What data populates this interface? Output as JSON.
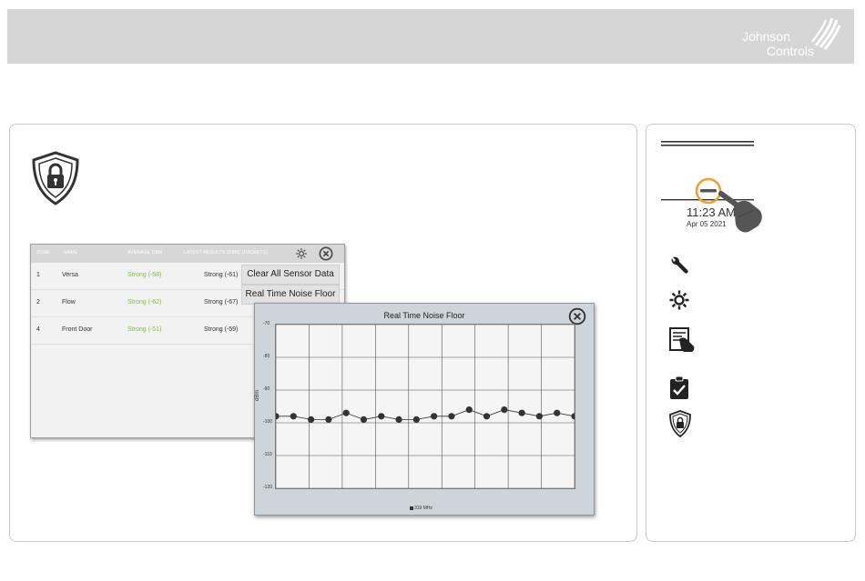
{
  "brand": {
    "line1": "Johnson",
    "line2": "Controls",
    "text_color": "#ffffff",
    "header_color": "#d6d6d6"
  },
  "sensor_table": {
    "headers": [
      "ZONE",
      "NAME",
      "AVERAGE DBM",
      "LATEST RESULTS (DBM) (PACKETS)"
    ],
    "rows": [
      {
        "zone": "1",
        "name": "Versa",
        "average": "Strong (-58)",
        "latest": "Strong (-61)"
      },
      {
        "zone": "2",
        "name": "Flow",
        "average": "Strong (-62)",
        "latest": "Strong (-67)"
      },
      {
        "zone": "4",
        "name": "Front Door",
        "average": "Strong (-51)",
        "latest": "Strong (-59)"
      }
    ],
    "menu": {
      "clear": "Clear All Sensor Data",
      "noise": "Real Time Noise Floor"
    },
    "good_color": "#7fbf3f"
  },
  "noise_window": {
    "title": "Real Time Noise Floor"
  },
  "chart_data": {
    "type": "line",
    "title": "Real Time Noise Floor",
    "ylabel": "dBm",
    "xlabel": "",
    "ylim": [
      -120,
      -70
    ],
    "yticks": [
      "-70",
      "-80",
      "-90",
      "-100",
      "-110",
      "-120"
    ],
    "x": [
      0,
      1,
      2,
      3,
      4,
      5,
      6,
      7,
      8,
      9,
      10,
      11,
      12,
      13,
      14,
      15,
      16,
      17
    ],
    "series": [
      {
        "name": "319 MHz",
        "values": [
          -98,
          -98,
          -99,
          -99,
          -97,
          -99,
          -98,
          -99,
          -99,
          -98,
          -98,
          -96,
          -98,
          -96,
          -97,
          -98,
          -97,
          -98
        ]
      }
    ],
    "grid": true,
    "legend": "bottom"
  },
  "status": {
    "time": "11:23 AM",
    "date": "Apr 05 2021"
  },
  "accent_color": "#f0a030",
  "icons": [
    "lock-shield-icon",
    "wrench-icon",
    "gear-icon",
    "sensor-touch-icon",
    "clipboard-check-icon",
    "shield-lock-icon",
    "hand-pointer-icon"
  ]
}
